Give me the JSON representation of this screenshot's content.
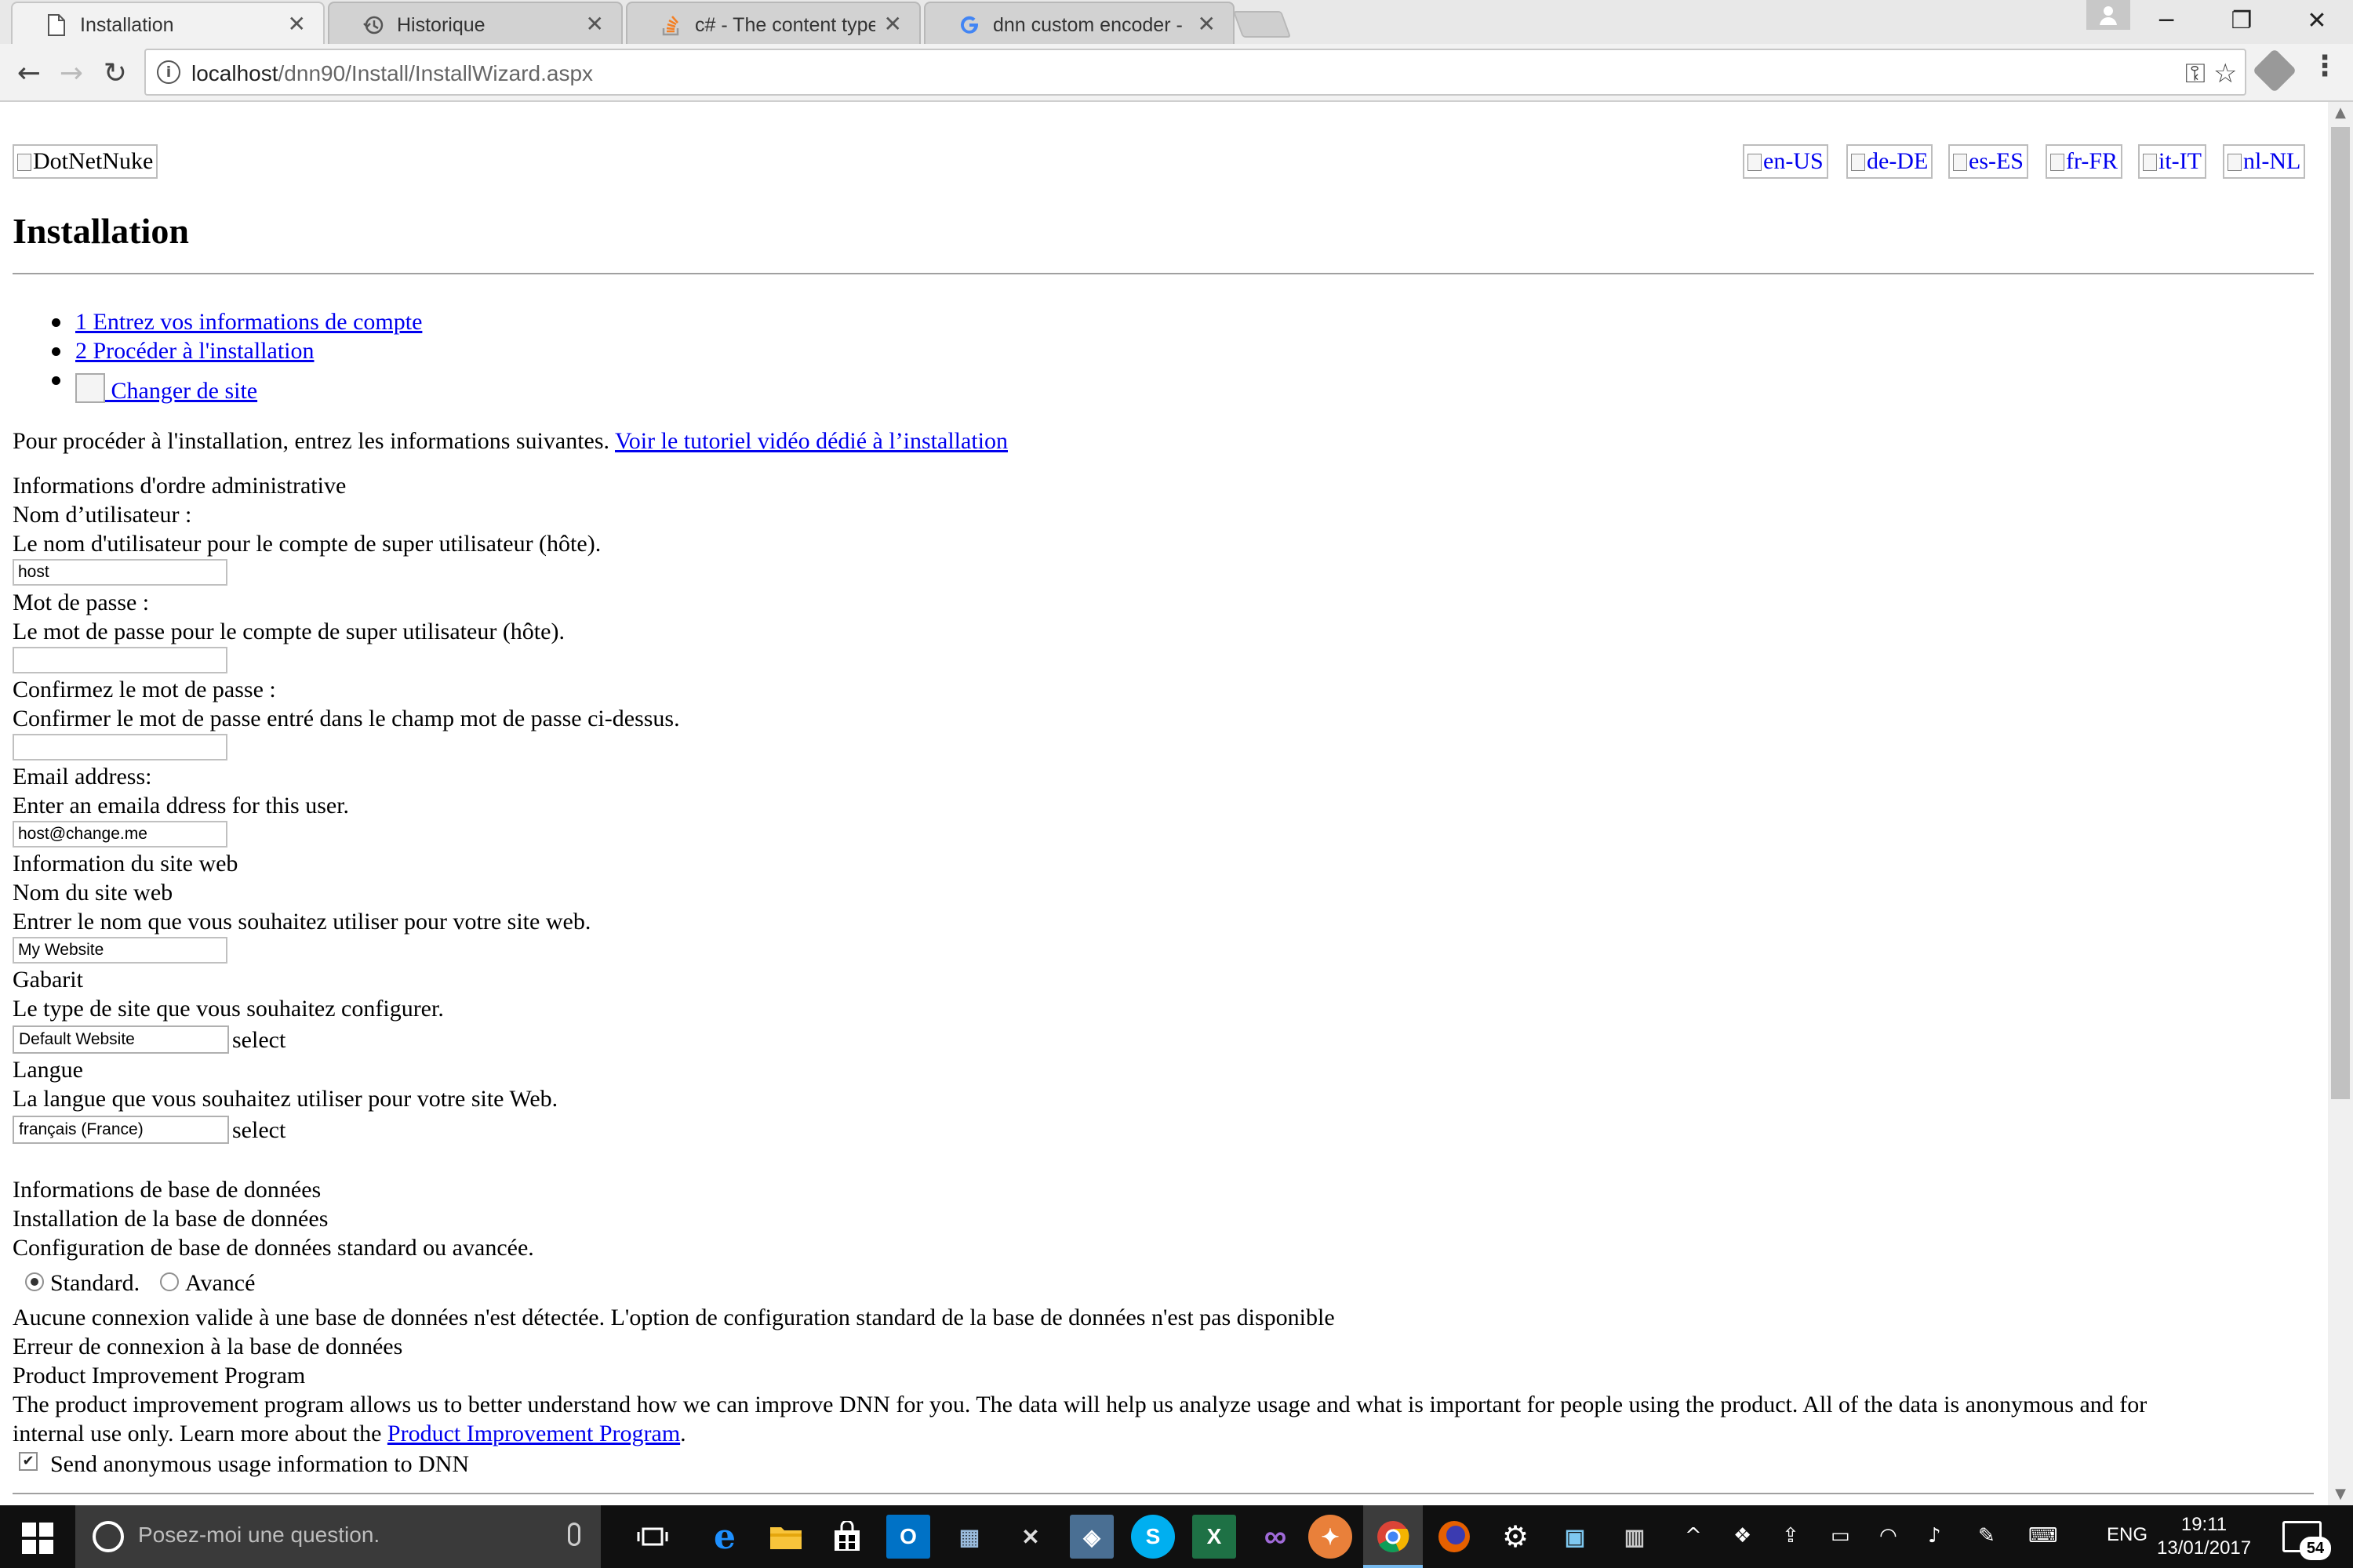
{
  "browser": {
    "tabs": [
      {
        "title": "Installation",
        "active": true
      },
      {
        "title": "Historique",
        "active": false
      },
      {
        "title": "c# - The content type te",
        "active": false
      },
      {
        "title": "dnn custom encoder - Re",
        "active": false
      }
    ],
    "url": {
      "host": "localhost",
      "path": "/dnn90/Install/InstallWizard.aspx"
    }
  },
  "page": {
    "logo_alt": "DotNetNuke",
    "languages": [
      "en-US",
      "de-DE",
      "es-ES",
      "fr-FR",
      "it-IT",
      "nl-NL"
    ],
    "title": "Installation",
    "steps": [
      "1 Entrez vos informations de compte",
      "2 Procéder à l'installation",
      "Changer de site"
    ],
    "intro": "Pour procéder à l'installation, entrez les informations suivantes.",
    "intro_link": "Voir le tutoriel vidéo dédié à l’installation",
    "admin": {
      "heading": "Informations d'ordre administrative",
      "username_label": "Nom d’utilisateur :",
      "username_help": "Le nom d'utilisateur pour le compte de super utilisateur (hôte).",
      "username_value": "host",
      "password_label": "Mot de passe :",
      "password_help": "Le mot de passe pour le compte de super utilisateur (hôte).",
      "password_value": "",
      "confirm_label": "Confirmez le mot de passe :",
      "confirm_help": "Confirmer le mot de passe entré dans le champ mot de passe ci-dessus.",
      "confirm_value": "",
      "email_label": "Email address:",
      "email_help": "Enter an emaila ddress for this user.",
      "email_value": "host@change.me"
    },
    "website": {
      "heading": "Information du site web",
      "name_label": "Nom du site web",
      "name_help": "Entrer le nom que vous souhaitez utiliser pour votre site web.",
      "name_value": "My Website",
      "template_label": "Gabarit",
      "template_help": "Le type de site que vous souhaitez configurer.",
      "template_value": "Default Website",
      "select_word": "select",
      "language_label": "Langue",
      "language_help": "La langue que vous souhaitez utiliser pour votre site Web.",
      "language_value": "français (France)"
    },
    "database": {
      "heading": "Informations de base de données",
      "install_label": "Installation de la base de données",
      "install_help": "Configuration de base de données standard ou avancée.",
      "option_standard": "Standard.",
      "option_advanced": "Avancé",
      "selected": "standard",
      "warning": "Aucune connexion valide à une base de données n'est détectée. L'option de configuration standard de la base de données n'est pas disponible",
      "error": "Erreur de connexion à la base de données"
    },
    "improvement": {
      "heading": "Product Improvement Program",
      "text_1": "The product improvement program allows us to better understand how we can improve DNN for you. The data will help us analyze usage and what is important for people using the product. All of the data is anonymous and for",
      "text_2": "internal use only. Learn more about the",
      "link": "Product Improvement Program",
      "text_end": ".",
      "checkbox_label": "Send anonymous usage information to DNN",
      "checked": true
    }
  },
  "taskbar": {
    "search_placeholder": "Posez-moi une question.",
    "language": "ENG",
    "time": "19:11",
    "date": "13/01/2017",
    "notifications": "54"
  }
}
